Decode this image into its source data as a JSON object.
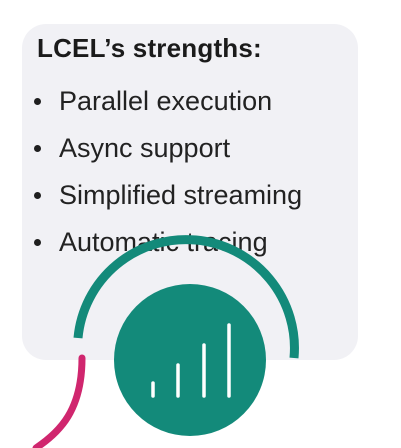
{
  "card": {
    "title": "LCEL’s strengths:",
    "items": [
      {
        "label": "Parallel execution"
      },
      {
        "label": "Async support"
      },
      {
        "label": "Simplified streaming"
      },
      {
        "label": "Automatic tracing"
      }
    ]
  },
  "colors": {
    "card_background": "#f1f1f5",
    "teal": "#138a7a",
    "magenta": "#d0266e",
    "text": "#222222"
  },
  "icon": {
    "name": "bar-chart-icon"
  }
}
